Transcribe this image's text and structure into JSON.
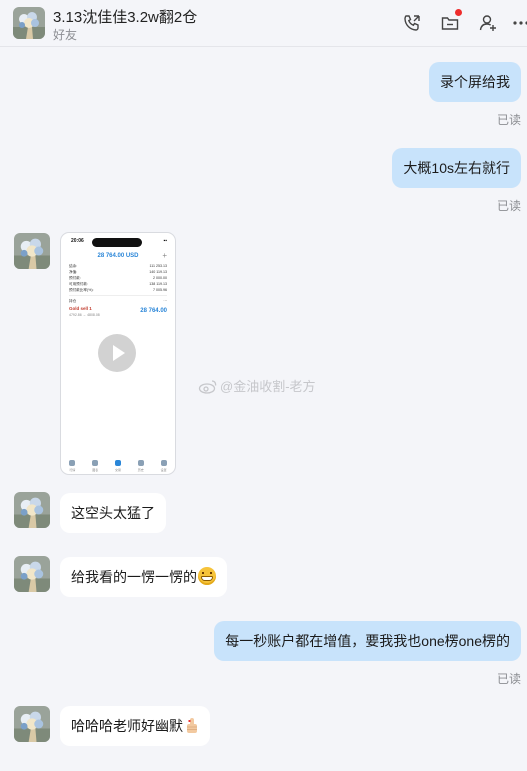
{
  "header": {
    "contact_name": "3.13沈佳佳3.2w翻2仓",
    "subtitle": "好友",
    "icons": [
      "call-icon",
      "folder-icon",
      "add-friend-icon",
      "more-icon"
    ]
  },
  "messages": [
    {
      "direction": "out",
      "text": "录个屏给我",
      "status": "已读"
    },
    {
      "direction": "out",
      "text": "大概10s左右就行",
      "status": "已读"
    },
    {
      "direction": "in",
      "type": "video",
      "video_preview": {
        "time": "20:06",
        "amount": "28 764.00 USD",
        "rows": [
          [
            "结余:",
            "111 253.13"
          ],
          [
            "净值:",
            "140 119.13"
          ],
          [
            "预付款:",
            "2 000.00"
          ],
          [
            "可用预付款:",
            "138 119.13"
          ],
          [
            "预付款比率(%):",
            "7 005.96"
          ]
        ],
        "section": "持仓",
        "position_name": "Gold sell 1",
        "position_sub": "4792.86 → 4808.08",
        "position_value": "28 764.00",
        "nav_labels": [
          "行情",
          "图表",
          "交易",
          "历史",
          "设置"
        ]
      }
    },
    {
      "direction": "in",
      "text": "这空头太猛了"
    },
    {
      "direction": "in",
      "text": "给我看的一愣一愣的",
      "emoji": "grinning-face"
    },
    {
      "direction": "out",
      "text": "每一秒账户都在增值，要我我也one楞one楞的",
      "status": "已读"
    },
    {
      "direction": "in",
      "text": "哈哈哈老师好幽默",
      "emoji": "thumbs-up"
    }
  ],
  "watermark": "@金油收割-老方",
  "colors": {
    "outgoing_bubble": "#c8e3fb",
    "incoming_bubble": "#ffffff",
    "background": "#f4f5f9",
    "accent": "#2a86d8"
  }
}
